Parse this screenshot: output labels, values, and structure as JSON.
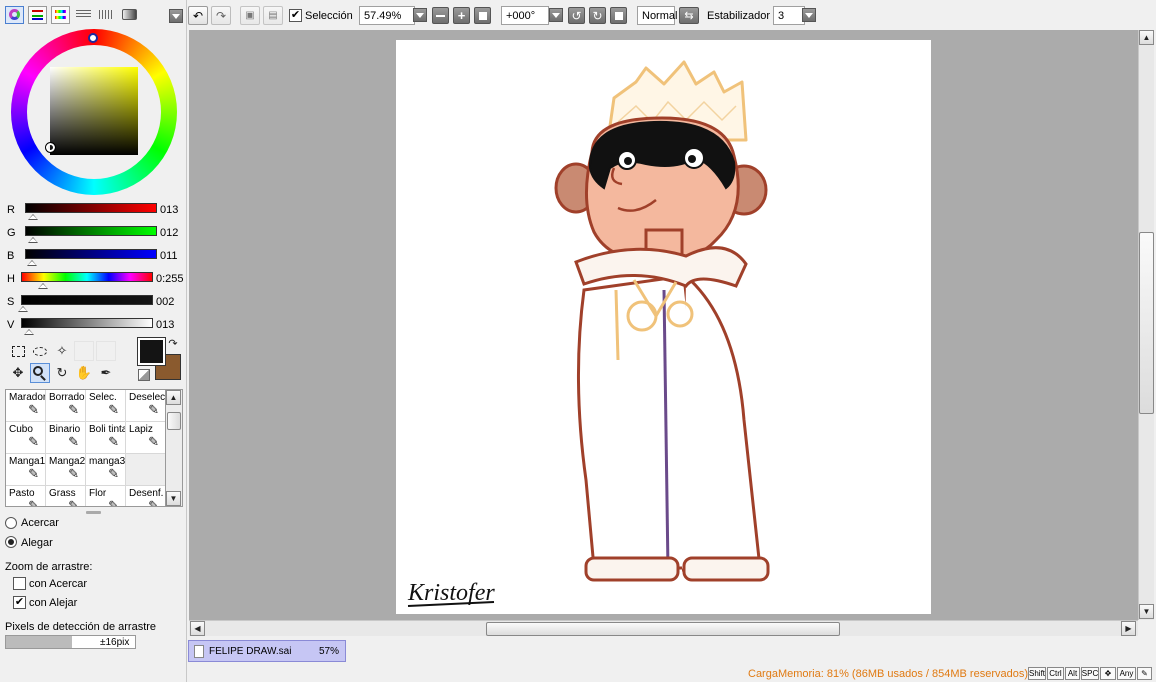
{
  "colors": {
    "primary": "#141414",
    "secondary": "#8a5a2e",
    "canvas_bg": "#ababab",
    "status_text": "#e07a12",
    "file_tab": "#c6c6f4"
  },
  "sliders": [
    {
      "label": "R",
      "value": "013",
      "fraction": 0.05
    },
    {
      "label": "G",
      "value": "012",
      "fraction": 0.05
    },
    {
      "label": "B",
      "value": "011",
      "fraction": 0.04
    },
    {
      "label": "H",
      "value": "0:255",
      "fraction": 0.17
    },
    {
      "label": "S",
      "value": "002",
      "fraction": 0.01
    },
    {
      "label": "V",
      "value": "013",
      "fraction": 0.05
    }
  ],
  "brushes": [
    {
      "label": "Marador",
      "icon": "marker-icon"
    },
    {
      "label": "Borrador",
      "icon": "eraser-icon"
    },
    {
      "label": "Selec.",
      "icon": "select-brush-icon"
    },
    {
      "label": "Deselec.",
      "icon": "deselect-brush-icon"
    },
    {
      "label": "Cubo",
      "icon": "bucket-icon"
    },
    {
      "label": "Binario",
      "icon": "binary-pen-icon"
    },
    {
      "label": "Boli tinta",
      "icon": "ink-pen-icon"
    },
    {
      "label": "Lapiz",
      "icon": "pencil-icon"
    },
    {
      "label": "Manga1",
      "icon": "pen-icon"
    },
    {
      "label": "Manga2",
      "icon": "pen-icon"
    },
    {
      "label": "manga3",
      "icon": "pen-icon"
    },
    {
      "label": "",
      "icon": ""
    },
    {
      "label": "Pasto",
      "icon": "pen-icon"
    },
    {
      "label": "Grass",
      "icon": "pen-icon"
    },
    {
      "label": "Flor",
      "icon": "pen-icon"
    },
    {
      "label": "Desenf.",
      "icon": "pen-icon"
    }
  ],
  "zoom_options": {
    "acercar": "Acercar",
    "alegar": "Alegar",
    "drag_title": "Zoom de arrastre:",
    "con_acercar": "con Acercar",
    "con_alejar": "con Alejar",
    "detect_label": "Pixels de detección de arrastre",
    "detect_value": "±16pix"
  },
  "toolbar": {
    "selection_label": "Selección",
    "zoom": "57.49%",
    "rotation": "+000°",
    "blend_mode": "Normal",
    "stabilizer_label": "Estabilizador",
    "stabilizer_value": "3"
  },
  "file_tab": {
    "name": "FELIPE DRAW.sai",
    "zoom": "57%"
  },
  "status": {
    "memory": "CargaMemoria: 81% (86MB usados / 854MB reservados)",
    "keys": [
      "Shift",
      "Ctrl",
      "Alt",
      "SPC",
      "Any"
    ]
  },
  "artwork": {
    "signature": "Kristofer"
  }
}
